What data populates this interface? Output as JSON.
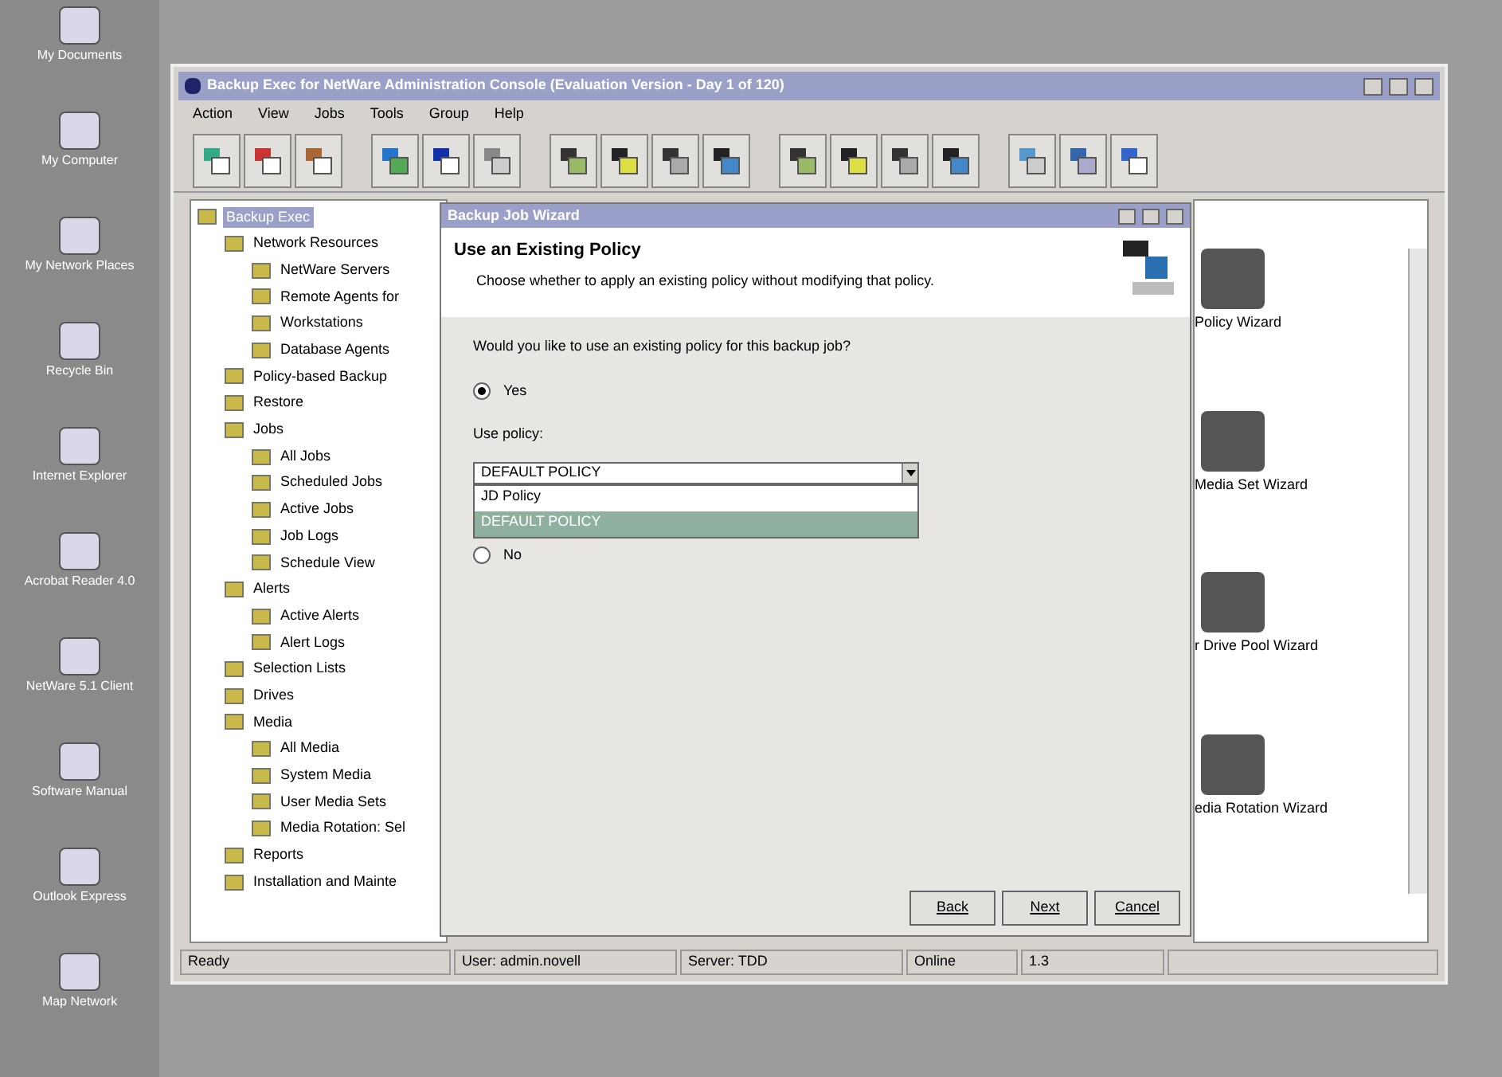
{
  "desktop_icons": [
    {
      "label": "My Documents"
    },
    {
      "label": "My Computer"
    },
    {
      "label": "My Network Places"
    },
    {
      "label": "Recycle Bin"
    },
    {
      "label": "Internet Explorer"
    },
    {
      "label": "Acrobat Reader 4.0"
    },
    {
      "label": "NetWare 5.1 Client"
    },
    {
      "label": "Software Manual"
    },
    {
      "label": "Outlook Express"
    },
    {
      "label": "Map Network"
    }
  ],
  "window": {
    "title": "Backup Exec for NetWare Administration Console (Evaluation Version - Day 1 of 120)"
  },
  "menu": [
    "Action",
    "View",
    "Jobs",
    "Tools",
    "Group",
    "Help"
  ],
  "tree": [
    {
      "label": "Backup Exec",
      "selected": true,
      "children": [
        {
          "label": "Network Resources",
          "selected": false,
          "children": [
            {
              "label": "NetWare Servers",
              "selected": false
            },
            {
              "label": "Remote Agents for",
              "selected": false
            },
            {
              "label": "Workstations",
              "selected": false
            },
            {
              "label": "Database Agents",
              "selected": false
            }
          ]
        },
        {
          "label": "Policy-based Backup",
          "selected": false
        },
        {
          "label": "Restore",
          "selected": false
        },
        {
          "label": "Jobs",
          "selected": false,
          "children": [
            {
              "label": "All Jobs",
              "selected": false
            },
            {
              "label": "Scheduled Jobs",
              "selected": false
            },
            {
              "label": "Active Jobs",
              "selected": false
            },
            {
              "label": "Job Logs",
              "selected": false
            },
            {
              "label": "Schedule View",
              "selected": false
            }
          ]
        },
        {
          "label": "Alerts",
          "selected": false,
          "children": [
            {
              "label": "Active Alerts",
              "selected": false
            },
            {
              "label": "Alert Logs",
              "selected": false
            }
          ]
        },
        {
          "label": "Selection Lists",
          "selected": false
        },
        {
          "label": "Drives",
          "selected": false
        },
        {
          "label": "Media",
          "selected": false,
          "children": [
            {
              "label": "All Media",
              "selected": false
            },
            {
              "label": "System Media",
              "selected": false
            },
            {
              "label": "User Media Sets",
              "selected": false
            },
            {
              "label": "Media Rotation: Sel",
              "selected": false
            }
          ]
        },
        {
          "label": "Reports",
          "selected": false
        },
        {
          "label": "Installation and Mainte",
          "selected": false
        }
      ]
    }
  ],
  "wizards": [
    {
      "label": "Policy Wizard"
    },
    {
      "label": "Media Set Wizard"
    },
    {
      "label": "r Drive Pool Wizard"
    },
    {
      "label": "edia Rotation Wizard"
    }
  ],
  "dialog": {
    "title": "Backup Job Wizard",
    "heading": "Use an Existing Policy",
    "subheading": "Choose whether to apply an existing policy without modifying that policy.",
    "question": "Would you like to use an existing policy for this backup job?",
    "options": [
      {
        "label": "Yes",
        "selected": true
      },
      {
        "label": "No",
        "selected": false
      }
    ],
    "policy_label": "Use policy:",
    "policy_value": "DEFAULT POLICY",
    "policy_list": [
      {
        "label": "JD Policy",
        "selected": false
      },
      {
        "label": "DEFAULT POLICY",
        "selected": true
      }
    ],
    "buttons": [
      "Back",
      "Next",
      "Cancel"
    ]
  },
  "status_bar": [
    "Ready",
    "User: admin.novell",
    "Server: TDD",
    "Online",
    "1.3"
  ]
}
